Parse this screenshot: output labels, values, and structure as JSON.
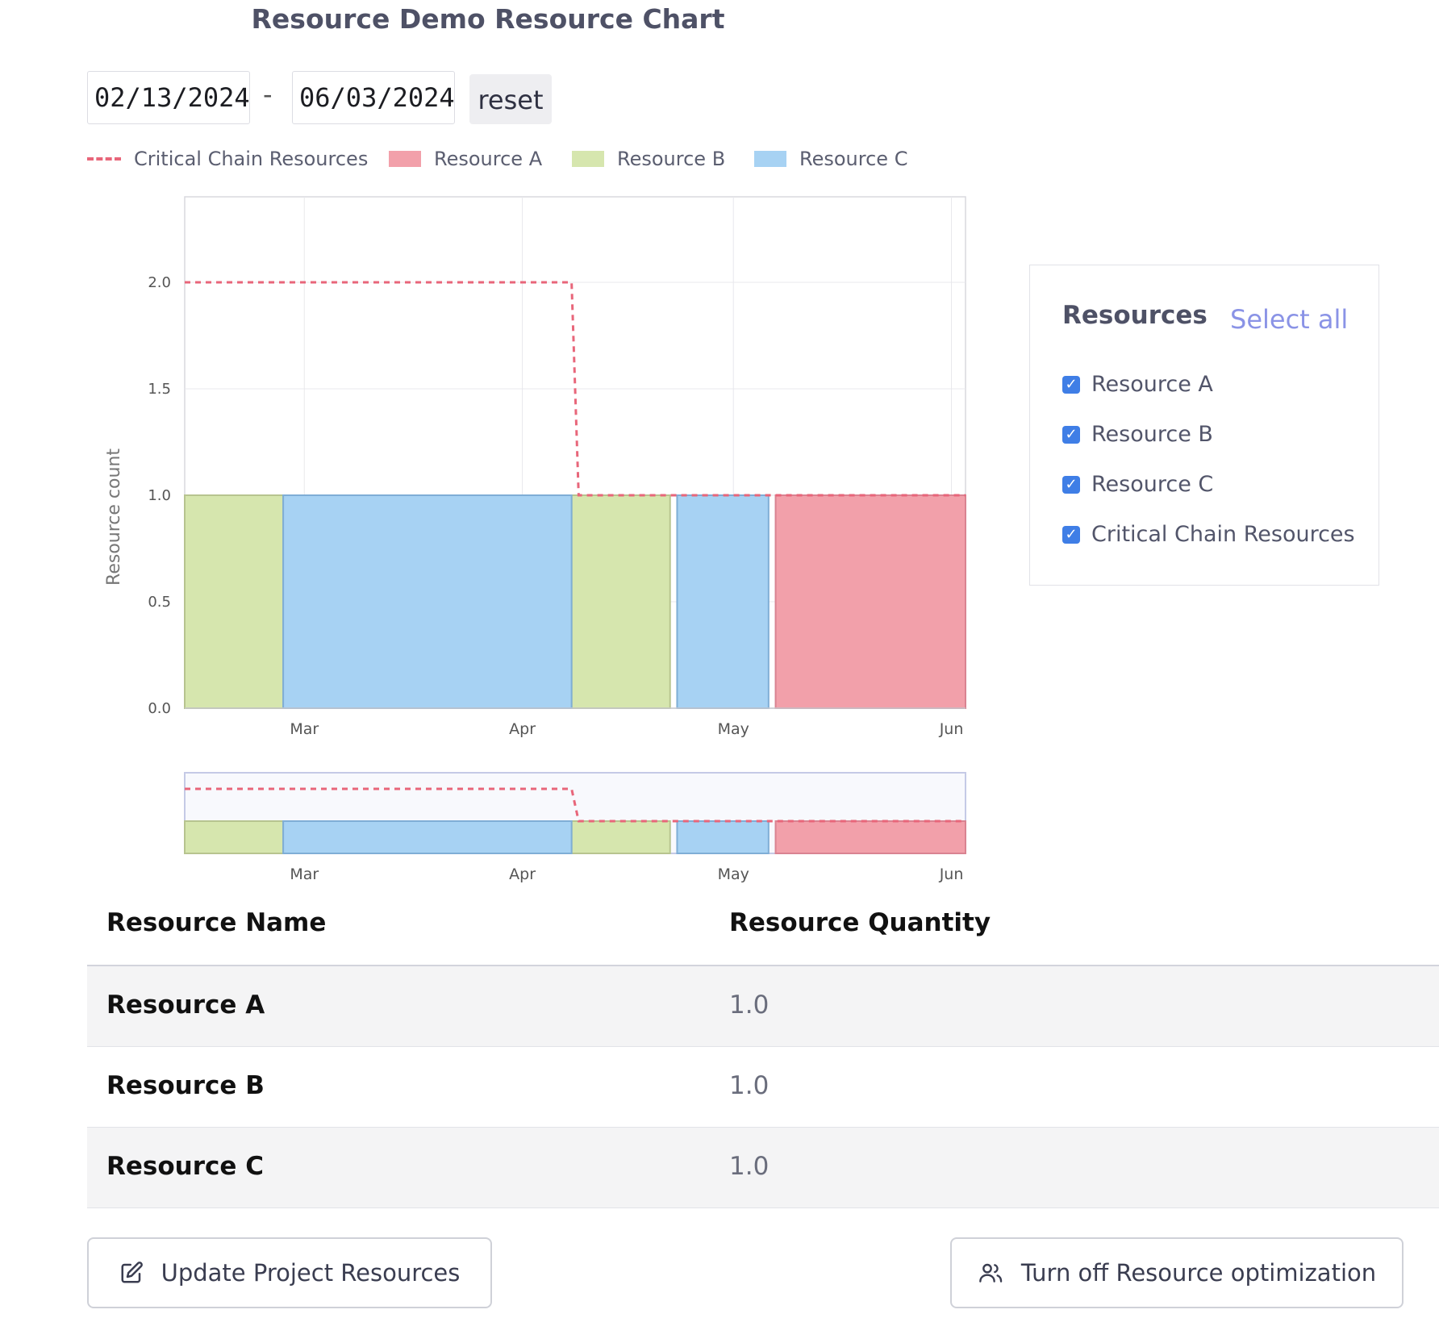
{
  "page": {
    "title": "Resource Demo Resource Chart"
  },
  "date_range": {
    "start": "02/13/2024",
    "separator": "-",
    "end": "06/03/2024",
    "reset_label": "reset"
  },
  "legend": [
    {
      "name": "Critical Chain Resources",
      "kind": "dashed-line",
      "color": "#e8667a"
    },
    {
      "name": "Resource A",
      "kind": "box",
      "color": "#f2a0aa"
    },
    {
      "name": "Resource B",
      "kind": "box",
      "color": "#d6e6ae"
    },
    {
      "name": "Resource C",
      "kind": "box",
      "color": "#a7d2f3"
    }
  ],
  "chart_data": {
    "type": "area",
    "ylabel": "Resource count",
    "ylim": [
      0,
      2.4
    ],
    "yticks": [
      "0.0",
      "0.5",
      "1.0",
      "1.5",
      "2.0"
    ],
    "xlim": [
      "2024-02-13",
      "2024-06-03"
    ],
    "xticks": [
      {
        "label": "Mar",
        "date": "2024-03-01"
      },
      {
        "label": "Apr",
        "date": "2024-04-01"
      },
      {
        "label": "May",
        "date": "2024-05-01"
      },
      {
        "label": "Jun",
        "date": "2024-06-01"
      }
    ],
    "grid": true,
    "series": [
      {
        "name": "Resource B",
        "color": "#d6e6ae",
        "edge": "#b7c48f",
        "segments": [
          {
            "start": "2024-02-13",
            "end": "2024-02-27",
            "value": 1.0
          },
          {
            "start": "2024-04-08",
            "end": "2024-04-22",
            "value": 1.0
          }
        ]
      },
      {
        "name": "Resource C",
        "color": "#a7d2f3",
        "edge": "#7faed6",
        "segments": [
          {
            "start": "2024-02-27",
            "end": "2024-04-08",
            "value": 1.0
          },
          {
            "start": "2024-04-23",
            "end": "2024-05-06",
            "value": 1.0
          }
        ]
      },
      {
        "name": "Resource A",
        "color": "#f2a0aa",
        "edge": "#d98391",
        "segments": [
          {
            "start": "2024-05-07",
            "end": "2024-06-03",
            "value": 1.0
          }
        ]
      },
      {
        "name": "Critical Chain Resources",
        "color": "#e8667a",
        "kind": "step-line",
        "points": [
          {
            "date": "2024-02-13",
            "value": 2.0
          },
          {
            "date": "2024-04-08",
            "value": 2.0
          },
          {
            "date": "2024-04-09",
            "value": 1.0
          },
          {
            "date": "2024-06-03",
            "value": 1.0
          }
        ]
      }
    ]
  },
  "navigator": {
    "xticks": [
      "Mar",
      "Apr",
      "May",
      "Jun"
    ]
  },
  "resources_panel": {
    "heading": "Resources",
    "select_all_label": "Select all",
    "items": [
      {
        "label": "Resource A",
        "checked": true
      },
      {
        "label": "Resource B",
        "checked": true
      },
      {
        "label": "Resource C",
        "checked": true
      },
      {
        "label": "Critical Chain Resources",
        "checked": true
      }
    ]
  },
  "table": {
    "headers": {
      "name": "Resource Name",
      "quantity": "Resource Quantity"
    },
    "rows": [
      {
        "name": "Resource A",
        "quantity": "1.0"
      },
      {
        "name": "Resource B",
        "quantity": "1.0"
      },
      {
        "name": "Resource C",
        "quantity": "1.0"
      }
    ]
  },
  "actions": {
    "update_label": "Update Project Resources",
    "toggle_optimization_label": "Turn off Resource optimization"
  }
}
